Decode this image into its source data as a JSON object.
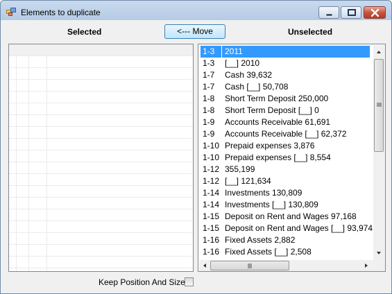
{
  "window": {
    "title": "Elements to duplicate",
    "icon": "app-window-icon"
  },
  "headers": {
    "selected": "Selected",
    "unselected": "Unselected"
  },
  "buttons": {
    "move": "<--- Move"
  },
  "unselected_list": {
    "items": [
      {
        "code": "1-3",
        "label": " 2011",
        "selected": true
      },
      {
        "code": "1-3",
        "label": " [__] 2010"
      },
      {
        "code": "1-7",
        "label": "Cash 39,632"
      },
      {
        "code": "1-7",
        "label": "Cash [__] 50,708"
      },
      {
        "code": "1-8",
        "label": "Short Term Deposit 250,000"
      },
      {
        "code": "1-8",
        "label": "Short Term Deposit [__] 0"
      },
      {
        "code": "1-9",
        "label": "Accounts Receivable 61,691"
      },
      {
        "code": "1-9",
        "label": "Accounts Receivable [__] 62,372"
      },
      {
        "code": "1-10",
        "label": "Prepaid expenses 3,876"
      },
      {
        "code": "1-10",
        "label": "Prepaid expenses [__] 8,554"
      },
      {
        "code": "1-12",
        "label": " 355,199"
      },
      {
        "code": "1-12",
        "label": " [__] 121,634"
      },
      {
        "code": "1-14",
        "label": "Investments 130,809"
      },
      {
        "code": "1-14",
        "label": "Investments [__] 130,809"
      },
      {
        "code": "1-15",
        "label": "Deposit on Rent and Wages 97,168"
      },
      {
        "code": "1-15",
        "label": "Deposit on Rent and Wages [__] 93,974"
      },
      {
        "code": "1-16",
        "label": "Fixed Assets 2,882"
      },
      {
        "code": "1-16",
        "label": "Fixed Assets [__] 2,508"
      }
    ]
  },
  "footer": {
    "keep_position_label": "Keep Position And Size",
    "keep_position_checked": false
  },
  "colors": {
    "selection": "#3399ff",
    "title_bar": "#c9daee",
    "close_button": "#c8553f"
  }
}
